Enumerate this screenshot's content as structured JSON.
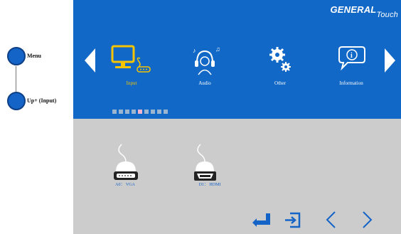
{
  "callouts": [
    {
      "label": "Menu"
    },
    {
      "label": "Up+ (Input)"
    }
  ],
  "brand": {
    "name": "GENERAL",
    "sub": "Touch"
  },
  "menu": {
    "items": [
      {
        "label": "Input",
        "icon": "monitor-icon",
        "selected": true
      },
      {
        "label": "Audio",
        "icon": "headphones-icon",
        "selected": false
      },
      {
        "label": "Other",
        "icon": "gears-icon",
        "selected": false
      },
      {
        "label": "Information",
        "icon": "info-icon",
        "selected": false
      }
    ],
    "page_indicator": {
      "count": 9,
      "active_index": 4
    }
  },
  "sources": [
    {
      "label": "A0： VGA",
      "icon": "vga-connector-icon"
    },
    {
      "label": "D1： HDMI",
      "icon": "hdmi-connector-icon"
    }
  ],
  "nav_buttons": [
    "enter-icon",
    "exit-icon",
    "chevron-left-icon",
    "chevron-right-icon"
  ],
  "colors": {
    "osd_blue": "#1268c6",
    "osd_gray": "#cccccc",
    "selected_text": "#f5c400",
    "indicator_active": "#f2b5cf"
  }
}
